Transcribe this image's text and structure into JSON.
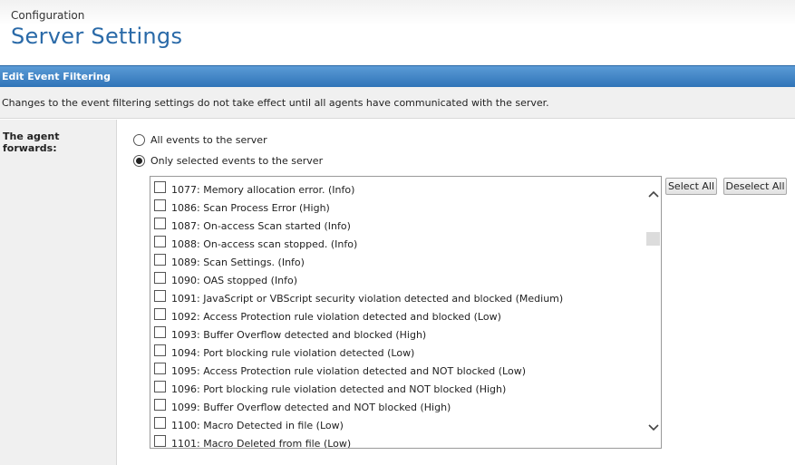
{
  "header": {
    "breadcrumb": "Configuration",
    "title": "Server Settings"
  },
  "section": {
    "title": "Edit Event Filtering",
    "notice": "Changes to the event filtering settings do not take effect until all agents have communicated with the server."
  },
  "form": {
    "label": "The agent forwards:",
    "options": [
      {
        "label": "All events to the server",
        "selected": false
      },
      {
        "label": "Only selected events to the server",
        "selected": true
      }
    ],
    "select_all": "Select All",
    "deselect_all": "Deselect All"
  },
  "events": [
    {
      "label": "1077: Memory allocation error. (Info)",
      "checked": false
    },
    {
      "label": "1086: Scan Process Error (High)",
      "checked": false
    },
    {
      "label": "1087: On-access Scan started (Info)",
      "checked": false
    },
    {
      "label": "1088: On-access scan stopped. (Info)",
      "checked": false
    },
    {
      "label": "1089: Scan Settings. (Info)",
      "checked": false
    },
    {
      "label": "1090: OAS stopped (Info)",
      "checked": false
    },
    {
      "label": "1091: JavaScript or VBScript security violation detected and blocked (Medium)",
      "checked": false
    },
    {
      "label": "1092: Access Protection rule violation detected and blocked (Low)",
      "checked": false
    },
    {
      "label": "1093: Buffer Overflow detected and blocked (High)",
      "checked": false
    },
    {
      "label": "1094: Port blocking rule violation detected (Low)",
      "checked": false
    },
    {
      "label": "1095: Access Protection rule violation detected and NOT blocked (Low)",
      "checked": false
    },
    {
      "label": "1096: Port blocking rule violation detected and NOT blocked (High)",
      "checked": false
    },
    {
      "label": "1099: Buffer Overflow detected and NOT blocked (High)",
      "checked": false
    },
    {
      "label": "1100: Macro Detected in file (Low)",
      "checked": false
    },
    {
      "label": "1101: Macro Deleted from file (Low)",
      "checked": false
    }
  ],
  "scrollbar": {
    "up_icon": "chevron-up-icon",
    "down_icon": "chevron-down-icon"
  }
}
